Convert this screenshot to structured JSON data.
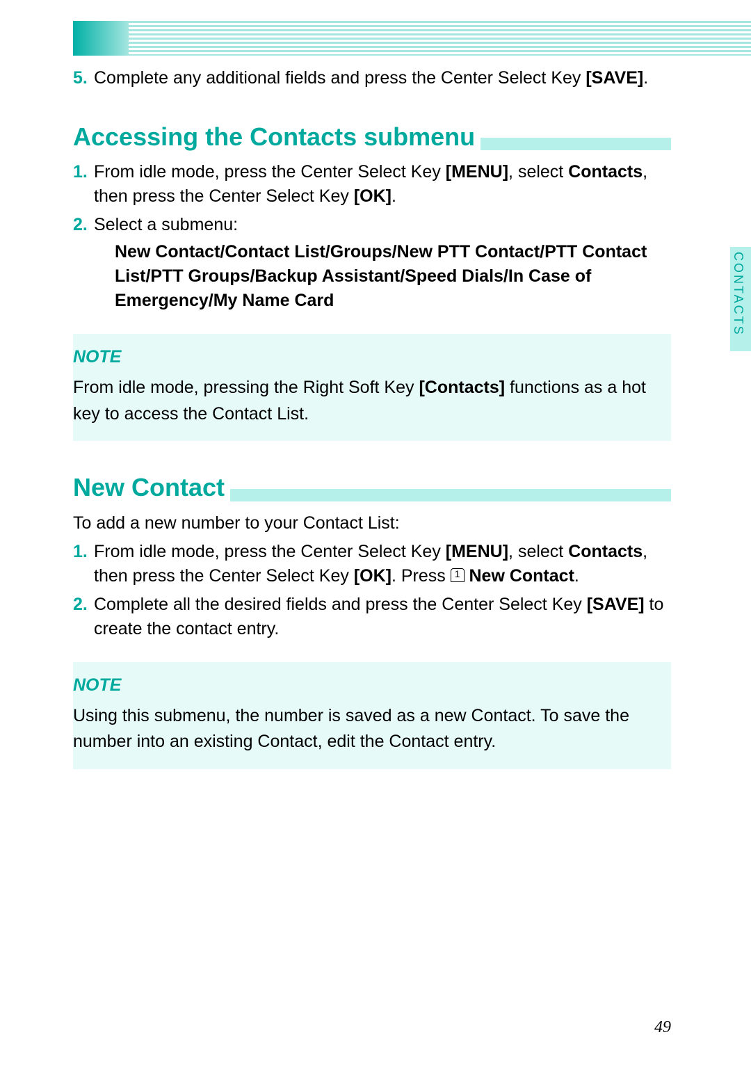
{
  "sideTab": "CONTACTS",
  "pageNumber": "49",
  "step5": {
    "num": "5.",
    "text_before": "Complete any additional fields and press the Center Select Key ",
    "save": "[SAVE]",
    "text_after": "."
  },
  "heading1": "Accessing the Contacts submenu",
  "h1_steps": {
    "s1": {
      "num": "1.",
      "t1": "From idle mode, press the Center Select Key ",
      "menu": "[MENU]",
      "t2": ", select ",
      "contacts": "Contacts",
      "t3": ", then press the Center Select Key ",
      "ok": "[OK]",
      "t4": "."
    },
    "s2": {
      "num": "2.",
      "t1": "Select a submenu:",
      "menuList": "New Contact/Contact List/Groups/New PTT Contact/PTT Contact List/PTT Groups/Backup Assistant/Speed Dials/In Case of Emergency/My Name Card"
    }
  },
  "note1": {
    "label": "NOTE",
    "t1": "From idle mode, pressing the Right Soft Key ",
    "contacts": "[Contacts]",
    "t2": " functions as a hot key to access the Contact List."
  },
  "heading2": "New Contact",
  "h2_intro": "To add a new number to your Contact List:",
  "h2_steps": {
    "s1": {
      "num": "1.",
      "t1": "From idle mode, press the Center Select Key ",
      "menu": "[MENU]",
      "t2": ", select ",
      "contacts": "Contacts",
      "t3": ", then press the Center Select Key ",
      "ok": "[OK]",
      "t4": ". Press ",
      "keyIcon": "1",
      "newContact": "New Contact",
      "t5": "."
    },
    "s2": {
      "num": "2.",
      "t1": "Complete all the desired fields and press the Center Select Key ",
      "save": "[SAVE]",
      "t2": " to create the contact entry."
    }
  },
  "note2": {
    "label": "NOTE",
    "body": "Using this submenu, the number is saved as a new Contact. To save the number into an existing Contact, edit the Contact entry."
  }
}
